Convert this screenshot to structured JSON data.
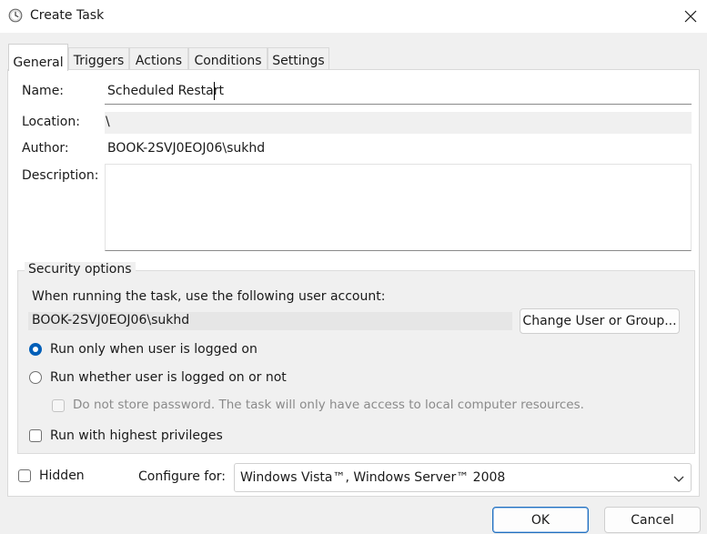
{
  "window": {
    "title": "Create Task",
    "app_icon": "clock-icon",
    "close_icon": "close-icon"
  },
  "tabs": [
    {
      "label": "General",
      "active": true
    },
    {
      "label": "Triggers",
      "active": false
    },
    {
      "label": "Actions",
      "active": false
    },
    {
      "label": "Conditions",
      "active": false
    },
    {
      "label": "Settings",
      "active": false
    }
  ],
  "general": {
    "name_label": "Name:",
    "name_value": "Scheduled Restart",
    "location_label": "Location:",
    "location_value": "\\",
    "author_label": "Author:",
    "author_value": "BOOK-2SVJ0EOJ06\\sukhd",
    "description_label": "Description:",
    "description_value": ""
  },
  "security": {
    "title": "Security options",
    "prompt": "When running the task, use the following user account:",
    "account": "BOOK-2SVJ0EOJ06\\sukhd",
    "change_button": "Change User or Group...",
    "radio_logged_on": {
      "label": "Run only when user is logged on",
      "selected": true
    },
    "radio_whether": {
      "label": "Run whether user is logged on or not",
      "selected": false
    },
    "no_store_password": {
      "label": "Do not store password.  The task will only have access to local computer resources.",
      "checked": false,
      "enabled": false
    },
    "highest_privileges": {
      "label": "Run with highest privileges",
      "checked": false
    }
  },
  "footer": {
    "hidden": {
      "label": "Hidden",
      "checked": false
    },
    "configure_label": "Configure for:",
    "configure_value": "Windows Vista™, Windows Server™ 2008"
  },
  "buttons": {
    "ok": "OK",
    "cancel": "Cancel"
  },
  "colors": {
    "accent": "#005fb8",
    "window_bg": "#f0f0f0"
  }
}
